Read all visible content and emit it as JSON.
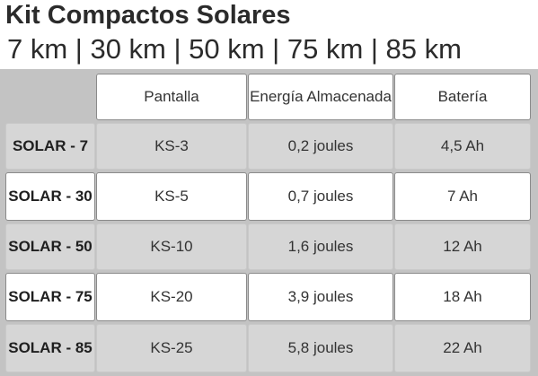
{
  "title": "Kit Compactos Solares",
  "subtitle": "7 km | 30 km | 50 km | 75 km | 85 km",
  "table": {
    "headers": [
      "Pantalla",
      "Energía Almacenada",
      "Batería"
    ],
    "rows": [
      {
        "label": "SOLAR - 7",
        "cells": [
          "KS-3",
          "0,2 joules",
          "4,5 Ah"
        ]
      },
      {
        "label": "SOLAR - 30",
        "cells": [
          "KS-5",
          "0,7 joules",
          "7 Ah"
        ]
      },
      {
        "label": "SOLAR - 50",
        "cells": [
          "KS-10",
          "1,6 joules",
          "12 Ah"
        ]
      },
      {
        "label": "SOLAR - 75",
        "cells": [
          "KS-20",
          "3,9 joules",
          "18 Ah"
        ]
      },
      {
        "label": "SOLAR - 85",
        "cells": [
          "KS-25",
          "5,8 joules",
          "22 Ah"
        ]
      }
    ]
  }
}
